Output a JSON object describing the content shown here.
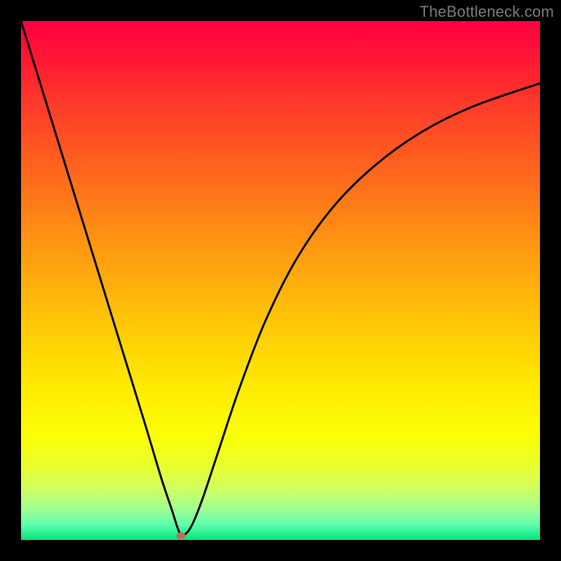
{
  "watermark": "TheBottleneck.com",
  "chart_data": {
    "type": "line",
    "title": "",
    "xlabel": "",
    "ylabel": "",
    "xlim": [
      0,
      100
    ],
    "ylim": [
      0,
      100
    ],
    "grid": false,
    "series": [
      {
        "name": "curve",
        "x": [
          0,
          4,
          8,
          12,
          16,
          20,
          24,
          27,
          29,
          30.5,
          31.5,
          33,
          35,
          38,
          42,
          47,
          53,
          60,
          68,
          77,
          87,
          100
        ],
        "y": [
          100,
          87,
          74,
          61,
          48,
          35,
          22,
          12,
          6,
          1.5,
          1,
          3,
          8,
          17,
          29,
          42,
          54,
          64,
          72,
          78.5,
          83.5,
          88
        ]
      }
    ],
    "marker": {
      "x": 30.8,
      "y": 0.8,
      "color": "#c26a5a"
    },
    "background_gradient": {
      "stops": [
        {
          "pos": 0.0,
          "color": "#ff0040"
        },
        {
          "pos": 0.5,
          "color": "#ffb000"
        },
        {
          "pos": 0.8,
          "color": "#f8ff10"
        },
        {
          "pos": 1.0,
          "color": "#00e676"
        }
      ]
    }
  }
}
